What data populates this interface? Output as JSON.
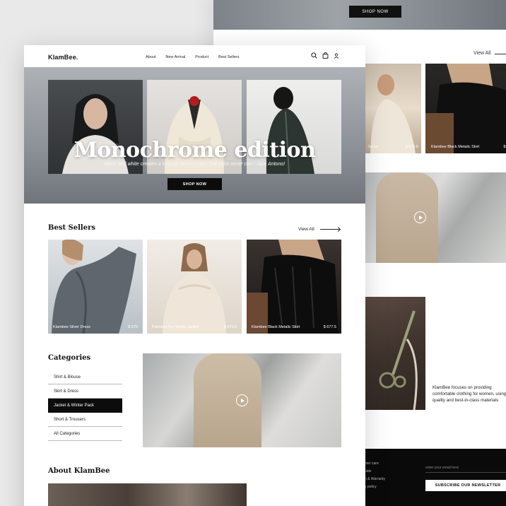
{
  "bg_page": {
    "shop_now": "SHOP NOW",
    "view_all": "View All",
    "cards": [
      {
        "name": "Jacket",
        "price": "$ 675.5"
      },
      {
        "name": "Klambee Black Metalic Skirt",
        "price": "$ 6"
      }
    ],
    "about_text": "KlamBee focuses on providing comfortable clothing for women, using quality and best-in-class materials",
    "footer": {
      "links": [
        "mer care",
        "uide",
        "n & Warranty",
        "y policy"
      ],
      "email_placeholder": "enter your email here",
      "subscribe": "SUBSCRIBE OUR NEWSLETTER"
    }
  },
  "nav": {
    "logo": "KlamBee.",
    "links": [
      "About",
      "New Arrival",
      "Product",
      "Best Sellers"
    ]
  },
  "hero": {
    "title": "Monochrome edition",
    "subtitle": "Black and white creates a strange dreamscape that color never can - Jack Antono!",
    "cta": "SHOP NOW"
  },
  "best_sellers": {
    "heading": "Best Sellers",
    "view_all": "View All",
    "products": [
      {
        "name": "Klambee Silver Dress",
        "price": "$ 570"
      },
      {
        "name": "Klambee Fur Winter Jacket",
        "price": "$ 675.5"
      },
      {
        "name": "Klambee Black Metalic Skirt",
        "price": "$ 677.5"
      }
    ]
  },
  "categories": {
    "heading": "Categories",
    "items": [
      "Shirt & Blouse",
      "Skirt & Dress",
      "Jacket & Winter Pack",
      "Short & Trousers",
      "All Categories"
    ],
    "active_index": 2
  },
  "about": {
    "heading": "About KlamBee"
  },
  "colors": {
    "accent": "#0c0c0c",
    "background": "#e9e9ea"
  }
}
